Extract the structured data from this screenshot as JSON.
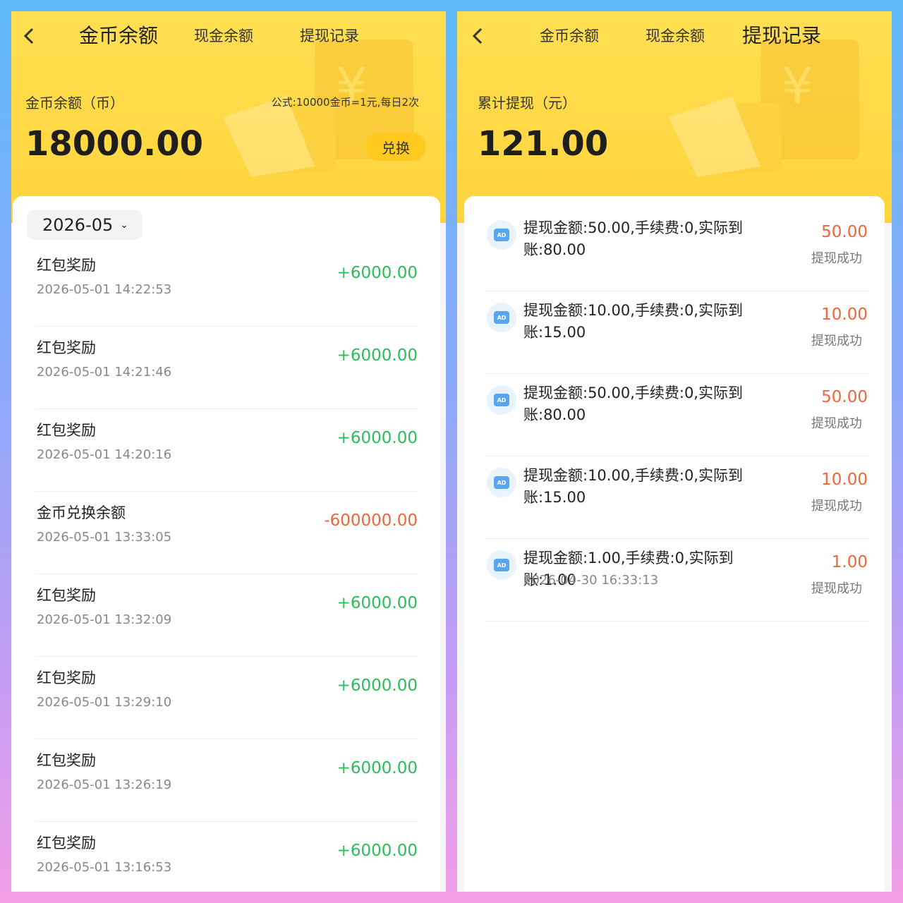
{
  "left": {
    "tabs": [
      "金币余额",
      "现金余额",
      "提现记录"
    ],
    "balance_label": "金币余额（币）",
    "formula": "公式:10000金币=1元,每日2次",
    "balance_value": "18000.00",
    "exchange_label": "兑换",
    "month": "2026-05",
    "transactions": [
      {
        "title": "红包奖励",
        "time": "2026-05-01 14:22:53",
        "amount": "+6000.00"
      },
      {
        "title": "红包奖励",
        "time": "2026-05-01 14:21:46",
        "amount": "+6000.00"
      },
      {
        "title": "红包奖励",
        "time": "2026-05-01 14:20:16",
        "amount": "+6000.00"
      },
      {
        "title": "金币兑换余额",
        "time": "2026-05-01 13:33:05",
        "amount": "-600000.00"
      },
      {
        "title": "红包奖励",
        "time": "2026-05-01 13:32:09",
        "amount": "+6000.00"
      },
      {
        "title": "红包奖励",
        "time": "2026-05-01 13:29:10",
        "amount": "+6000.00"
      },
      {
        "title": "红包奖励",
        "time": "2026-05-01 13:26:19",
        "amount": "+6000.00"
      },
      {
        "title": "红包奖励",
        "time": "2026-05-01 13:16:53",
        "amount": "+6000.00"
      }
    ]
  },
  "right": {
    "tabs": [
      "金币余额",
      "现金余额",
      "提现记录"
    ],
    "total_label": "累计提现（元）",
    "total_value": "121.00",
    "withdrawals": [
      {
        "line1": "提现金额:50.00,手续费:0,实际到",
        "line2": "账:80.00",
        "time": "",
        "amount": "50.00",
        "status": "提现成功"
      },
      {
        "line1": "提现金额:10.00,手续费:0,实际到",
        "line2": "账:15.00",
        "time": "",
        "amount": "10.00",
        "status": "提现成功"
      },
      {
        "line1": "提现金额:50.00,手续费:0,实际到",
        "line2": "账:80.00",
        "time": "",
        "amount": "50.00",
        "status": "提现成功"
      },
      {
        "line1": "提现金额:10.00,手续费:0,实际到",
        "line2": "账:15.00",
        "time": "",
        "amount": "10.00",
        "status": "提现成功"
      },
      {
        "line1": "提现金额:1.00,手续费:0,实际到账:1.00",
        "line2": "",
        "time": "2026-04-30 16:33:13",
        "amount": "1.00",
        "status": "提现成功"
      }
    ]
  },
  "colors": {
    "positive": "#2bbd5a",
    "negative": "#f0663a",
    "header": "#ffd83f"
  },
  "icons": {
    "back": "chevron-left-icon",
    "dropdown": "chevron-down-icon",
    "ad": "ad-badge-icon"
  }
}
